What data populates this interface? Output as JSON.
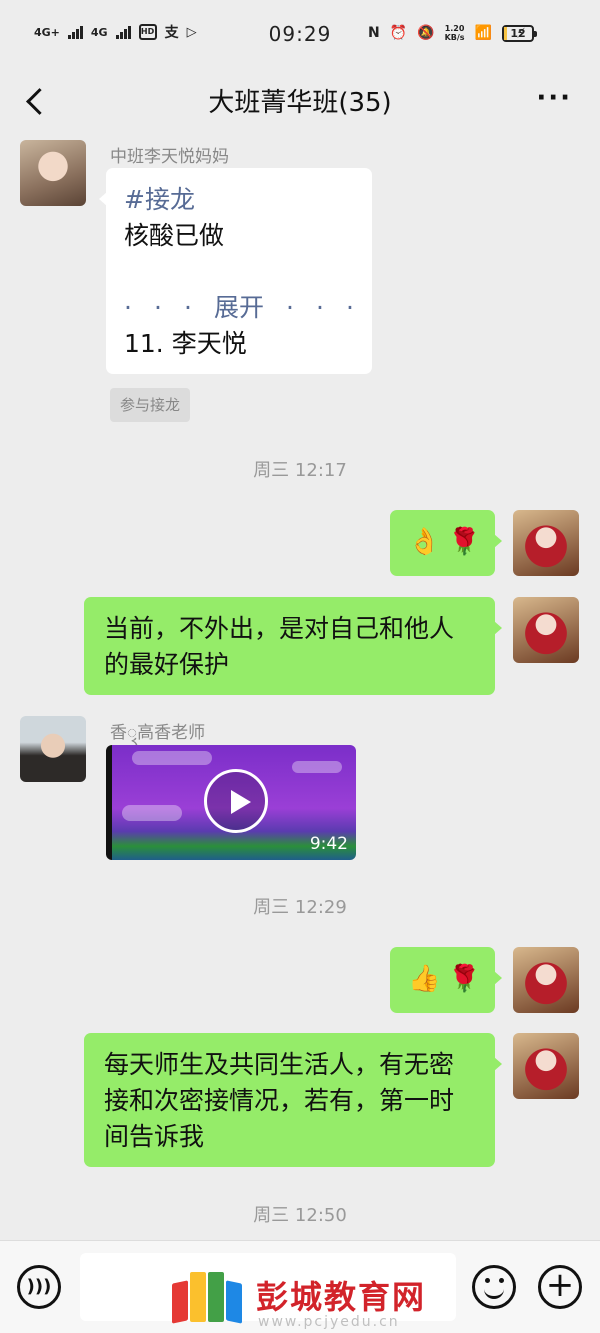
{
  "status_bar": {
    "network_1": "4G+",
    "network_2": "4G",
    "hd_label": "HD",
    "time": "09:29",
    "net_speed_value": "1.20",
    "net_speed_unit": "KB/s",
    "battery_level": "12",
    "battery_fraction": 0.12
  },
  "header": {
    "title": "大班菁华班(35)",
    "more": "···"
  },
  "messages": {
    "m1": {
      "sender": "中班李天悦妈妈",
      "tag": "#接龙",
      "line1": "核酸已做",
      "expand": "展开",
      "entry": "11. 李天悦",
      "join_button": "参与接龙"
    },
    "ts1": "周三 12:17",
    "m2": {
      "emoji1": "👌",
      "emoji2": "🌹"
    },
    "m3": {
      "text": "当前，不外出，是对自己和他人的最好保护"
    },
    "m4": {
      "sender": "香ꦽ高香老师",
      "video_duration": "9:42"
    },
    "ts2": "周三 12:29",
    "m5": {
      "emoji1": "👍",
      "emoji2": "🌹"
    },
    "m6": {
      "text": "每天师生及共同生活人，有无密接和次密接情况，若有，第一时间告诉我"
    },
    "ts3": "周三 12:50"
  },
  "watermark": {
    "text": "彭城教育网",
    "url": "www.pcjyedu.cn"
  },
  "icons": {
    "back": "chevron-left-icon",
    "voice": "voice-icon",
    "emoji": "emoji-icon",
    "plus": "plus-icon",
    "play": "play-icon"
  },
  "colors": {
    "background": "#ededed",
    "bubble_self": "#95ec69",
    "bubble_other": "#ffffff",
    "link": "#576b95",
    "watermark_red": "#d2232a"
  }
}
